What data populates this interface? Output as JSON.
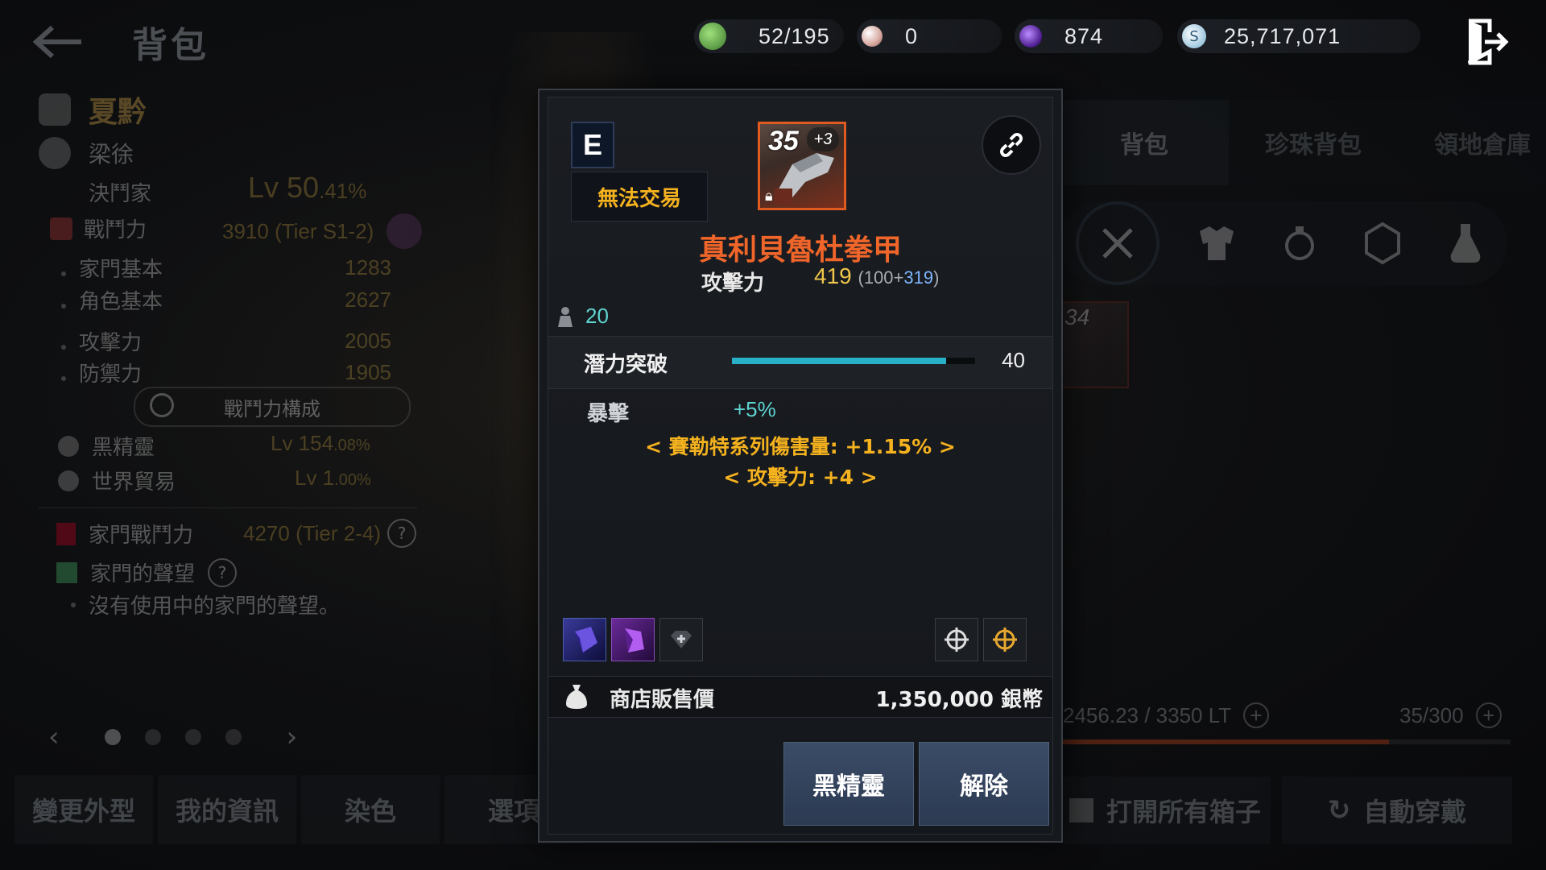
{
  "topbar": {
    "page_title": "背包",
    "currencies": [
      {
        "icon": "weight-bag-icon",
        "value": "52/195",
        "color": "#6dbb5a"
      },
      {
        "icon": "pearl-icon",
        "value": "0",
        "color": "#e8c7c0"
      },
      {
        "icon": "purple-orb-icon",
        "value": "874",
        "color": "#7b3fc4"
      },
      {
        "icon": "silver-coin-icon",
        "value": "25,717,071",
        "color": "#cfe4f2"
      }
    ]
  },
  "character": {
    "family_name": "夏黔",
    "name": "梁徐",
    "class": "決鬥家",
    "level": "Lv 50",
    "level_pct": ".41%",
    "combat_power_label": "戰鬥力",
    "combat_power": "3910 (Tier S1-2)",
    "stats": [
      {
        "label": "家門基本",
        "value": "1283"
      },
      {
        "label": "角色基本",
        "value": "2627"
      },
      {
        "label": "攻擊力",
        "value": "2005"
      },
      {
        "label": "防禦力",
        "value": "1905"
      }
    ],
    "cp_button": "戰鬥力構成",
    "black_spirit_label": "黑精靈",
    "black_spirit_level": "Lv 154",
    "black_spirit_pct": ".08%",
    "world_trade_label": "世界貿易",
    "world_trade_level": "Lv 1",
    "world_trade_pct": ".00%",
    "family_cp_label": "家門戰鬥力",
    "family_cp": "4270 (Tier 2-4)",
    "family_fame_label": "家門的聲望",
    "no_fame_text": "沒有使用中的家門的聲望。"
  },
  "bottom_tabs": [
    "變更外型",
    "我的資訊",
    "染色",
    "選項"
  ],
  "inventory": {
    "tabs": [
      "背包",
      "珍珠背包",
      "領地倉庫"
    ],
    "active_tab": 0,
    "categories": [
      "weapon-icon",
      "armor-icon",
      "accessory-icon",
      "material-icon",
      "potion-icon"
    ],
    "slot_item_text": "34",
    "weight": "2456.23 / 3350 LT",
    "weight_fill": 0.73,
    "slots": "35/300",
    "open_all_boxes": "打開所有箱子",
    "auto_equip": "自動穿戴"
  },
  "tooltip": {
    "grade": "E",
    "trade_status": "無法交易",
    "enhance": "35",
    "enhance_plus": "+3",
    "item_name": "真利貝魯杜拳甲",
    "attack_label": "攻擊力",
    "attack_value": "419",
    "attack_base": "(100+",
    "attack_bonus": "319",
    "attack_close": ")",
    "level_req": "20",
    "potential_label": "潛力突破",
    "potential_value": "40",
    "potential_fill": 0.88,
    "crit_label": "暴擊",
    "crit_value": "+5%",
    "bonus_lines": [
      "< 賽勒特系列傷害量: +1.15% >",
      "< 攻擊力: +4 >"
    ],
    "sell_label": "商店販售價",
    "sell_value": "1,350,000 銀幣",
    "btn_black_spirit": "黑精靈",
    "btn_unequip": "解除"
  },
  "colors": {
    "accent_orange": "#f0662a",
    "gold": "#f5b21f",
    "teal": "#5fd3d0",
    "button_blue": "#344561"
  }
}
